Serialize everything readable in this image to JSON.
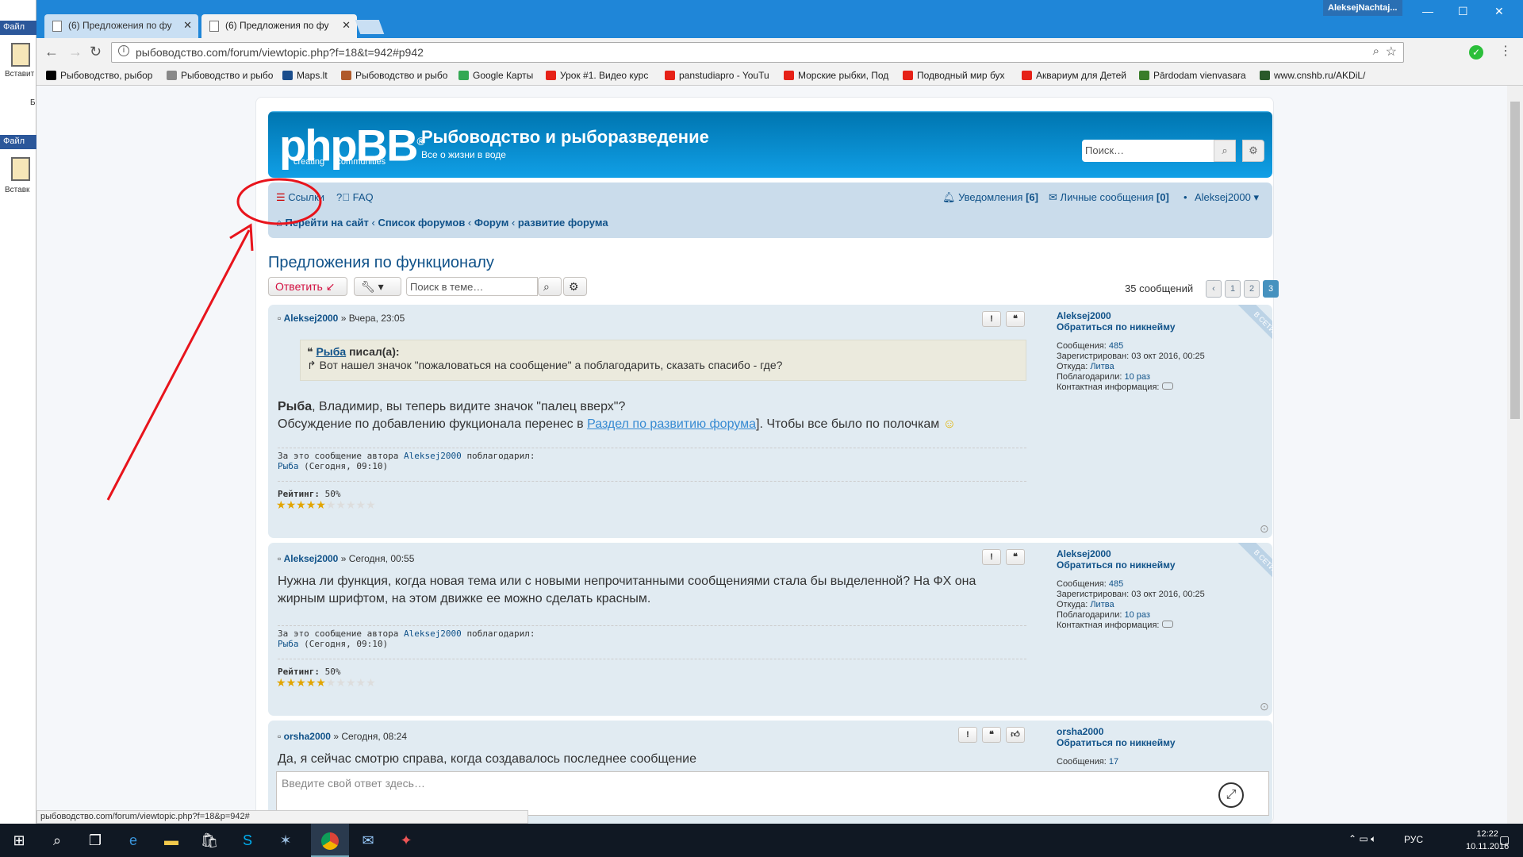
{
  "left_app": {
    "file_label": "Файл",
    "paste_label": "Вставит",
    "paste_label2": "Вставк",
    "b_label": "Б"
  },
  "browser": {
    "user_tag": "AleksejNachtaj...",
    "tabs": [
      {
        "label": "(6) Предложения по фу"
      },
      {
        "label": "(6) Предложения по фу"
      }
    ],
    "url": "рыбоводство.com/forum/viewtopic.php?f=18&t=942#p942",
    "bookmarks": [
      {
        "label": "Рыбоводство, рыбор",
        "color": "#000000"
      },
      {
        "label": "Рыбоводство и рыбо",
        "color": "#888888"
      },
      {
        "label": "Maps.lt",
        "color": "#1a4d8c"
      },
      {
        "label": "Рыбоводство и рыбо",
        "color": "#b05a2a"
      },
      {
        "label": "Google Карты",
        "color": "#34a853"
      },
      {
        "label": "Урок #1. Видео курс",
        "color": "#e62117"
      },
      {
        "label": "panstudiapro - YouTu",
        "color": "#e62117"
      },
      {
        "label": "Морские рыбки, Под",
        "color": "#e62117"
      },
      {
        "label": "Подводный мир бух",
        "color": "#e62117"
      },
      {
        "label": "Аквариум для Детей",
        "color": "#e62117"
      },
      {
        "label": "Pārdodam vienvasara",
        "color": "#3a7d2a"
      },
      {
        "label": "www.cnshb.ru/AKDiL/",
        "color": "#2a5a2a"
      }
    ],
    "status_url": "рыбоводство.com/forum/viewtopic.php?f=18&p=942#"
  },
  "forum": {
    "logo": "phpBB",
    "logo_reg": "®",
    "logo_sub1": "creating",
    "logo_sub2": "communities",
    "site_title": "Рыбоводство и рыборазведение",
    "site_desc": "Все о жизни в воде",
    "search_placeholder": "Поиск…",
    "nav": {
      "links": "Ссылки",
      "faq": "FAQ",
      "notifications": "Уведомления",
      "notifications_count": "[6]",
      "pm": "Личные сообщения",
      "pm_count": "[0]",
      "bullet": "•",
      "user": "Aleksej2000 ▾",
      "crumbs": [
        "Перейти на сайт",
        "Список форумов",
        "Форум",
        "развитие форума"
      ]
    },
    "topic_title": "Предложения по функционалу",
    "reply_button": "Ответить",
    "topic_search_placeholder": "Поиск в теме…",
    "post_count": "35 сообщений",
    "pages": [
      "1",
      "2",
      "3"
    ],
    "thanks_prefix": "За это сообщение автора",
    "thanks_suffix": "поблагодарил:",
    "rating_label": "Рейтинг:",
    "reply_placeholder": "Введите свой ответ здесь…",
    "posts": [
      {
        "author": "Aleksej2000",
        "date": "» Вчера, 23:05",
        "quote_author": "Рыба",
        "quote_wrote": "писал(а):",
        "quote_text": "Вот нашел значок \"пожаловаться на сообщение\" а поблагодарить, сказать спасибо - где?",
        "line1_bold": "Рыба",
        "line1_rest": ", Владимир, вы теперь видите значок \"палец вверх\"?",
        "line2_pre": "Обсуждение по добавлению фукционала перенес в ",
        "line2_link": "Раздел по развитию форума",
        "line2_post": "]. Чтобы все было по полочкам",
        "thanks_author": "Aleksej2000",
        "thanks_user": "Рыба",
        "thanks_date": "(Сегодня, 09:10)",
        "rating": "50%",
        "stars_filled": 5,
        "stars_total": 10,
        "profile": {
          "name": "Aleksej2000",
          "contact": "Обратиться по никнейму",
          "msgs_label": "Сообщения:",
          "msgs": "485",
          "reg_label": "Зарегистрирован:",
          "reg": "03 окт 2016, 00:25",
          "from_label": "Откуда:",
          "from": "Литва",
          "thanked_label": "Поблагодарили:",
          "thanked": "10 раз",
          "contact_label": "Контактная информация:",
          "online": "В СЕТИ"
        }
      },
      {
        "author": "Aleksej2000",
        "date": "» Сегодня, 00:55",
        "text1": "Нужна ли функция, когда новая тема или с новыми непрочитанными сообщениями стала бы выделенной? На ФХ она",
        "text2": "жирным шрифтом, на этом движке ее можно сделать красным.",
        "thanks_author": "Aleksej2000",
        "thanks_user": "Рыба",
        "thanks_date": "(Сегодня, 09:10)",
        "rating": "50%",
        "stars_filled": 5,
        "stars_total": 10,
        "profile": {
          "name": "Aleksej2000",
          "contact": "Обратиться по никнейму",
          "msgs_label": "Сообщения:",
          "msgs": "485",
          "reg_label": "Зарегистрирован:",
          "reg": "03 окт 2016, 00:25",
          "from_label": "Откуда:",
          "from": "Литва",
          "thanked_label": "Поблагодарили:",
          "thanked": "10 раз",
          "contact_label": "Контактная информация:",
          "online": "В СЕТИ"
        }
      },
      {
        "author": "orsha2000",
        "date": "» Сегодня, 08:24",
        "text1": "Да, я сейчас смотрю справа, когда создавалось последнее сообщение",
        "profile": {
          "name": "orsha2000",
          "contact": "Обратиться по никнейму",
          "msgs_label": "Сообщения:",
          "msgs": "17"
        }
      }
    ]
  },
  "taskbar": {
    "lang": "РУС",
    "time": "12:22",
    "date": "10.11.2016"
  },
  "colors": {
    "annotation": "#e8141c",
    "accent": "#105289",
    "header": "#12a3eb"
  }
}
